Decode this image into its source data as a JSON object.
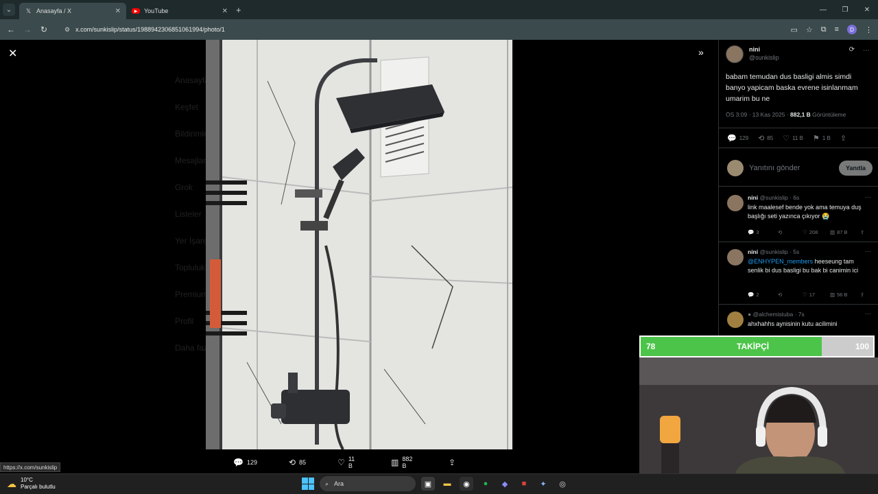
{
  "browser": {
    "tabs": [
      {
        "label": "Anasayfa / X",
        "icon": "x-logo-icon",
        "active": true
      },
      {
        "label": "YouTube",
        "icon": "youtube-icon",
        "active": false
      }
    ],
    "url": "x.com/sunkislip/status/1988942306851061994/photo/1",
    "profile_initial": "D",
    "status_url": "https://x.com/sunkislip"
  },
  "viewer": {
    "background_nav": [
      "Anasayfa",
      "Keşfet",
      "Bildirimler",
      "Mesajlar",
      "Grok",
      "Listeler",
      "Yer İşaretleri",
      "Topluluklar",
      "Premium",
      "Profil",
      "Daha fazla"
    ],
    "actions": {
      "replies": "129",
      "retweets": "85",
      "likes": "11 B",
      "views": "882 B"
    }
  },
  "post": {
    "name": "nini",
    "handle": "@sunkislip",
    "text": "babam temudan dus basligi almis simdi banyo yapicam baska evrene isinlanmam umarim bu ne",
    "meta_time": "ÖS 3:09 · 13 Kas 2025 · ",
    "views_count": "882,1 B",
    "views_label": " Görüntüleme",
    "stats": {
      "replies": "129",
      "retweets": "85",
      "likes": "11 B",
      "bookmarks": "1 B"
    },
    "reply_placeholder": "Yanıtını gönder",
    "reply_button": "Yanıtla"
  },
  "replies": [
    {
      "name": "nini",
      "meta": "@sunkislip · 6s",
      "mention": "",
      "text": "link maalesef bende yok ama temuya duş başlığı seti yazınca çıkıyor 😭",
      "stats": {
        "replies": "3",
        "retweets": "",
        "likes": "208",
        "views": "87 B"
      }
    },
    {
      "name": "nini",
      "meta": "@sunkislip · 5s",
      "mention": "@ENHYPEN_members",
      "text": " heeseung tam senlik bi dus basligi bu bak bi canimin ici",
      "stats": {
        "replies": "2",
        "retweets": "",
        "likes": "17",
        "views": "56 B"
      }
    },
    {
      "name": "",
      "meta": "@alchemistuba · 7s",
      "mention": "",
      "text": "ahxhahhs aynisinin kutu acilimini",
      "stats": {}
    }
  ],
  "overlay": {
    "follower_current": "78",
    "follower_label": "TAKİPÇİ",
    "follower_goal": "100",
    "follower_progress": 0.78,
    "accent": "#4cc449"
  },
  "taskbar": {
    "weather_temp": "10°C",
    "weather_desc": "Parçalı bulutlu",
    "search_label": "Ara"
  }
}
